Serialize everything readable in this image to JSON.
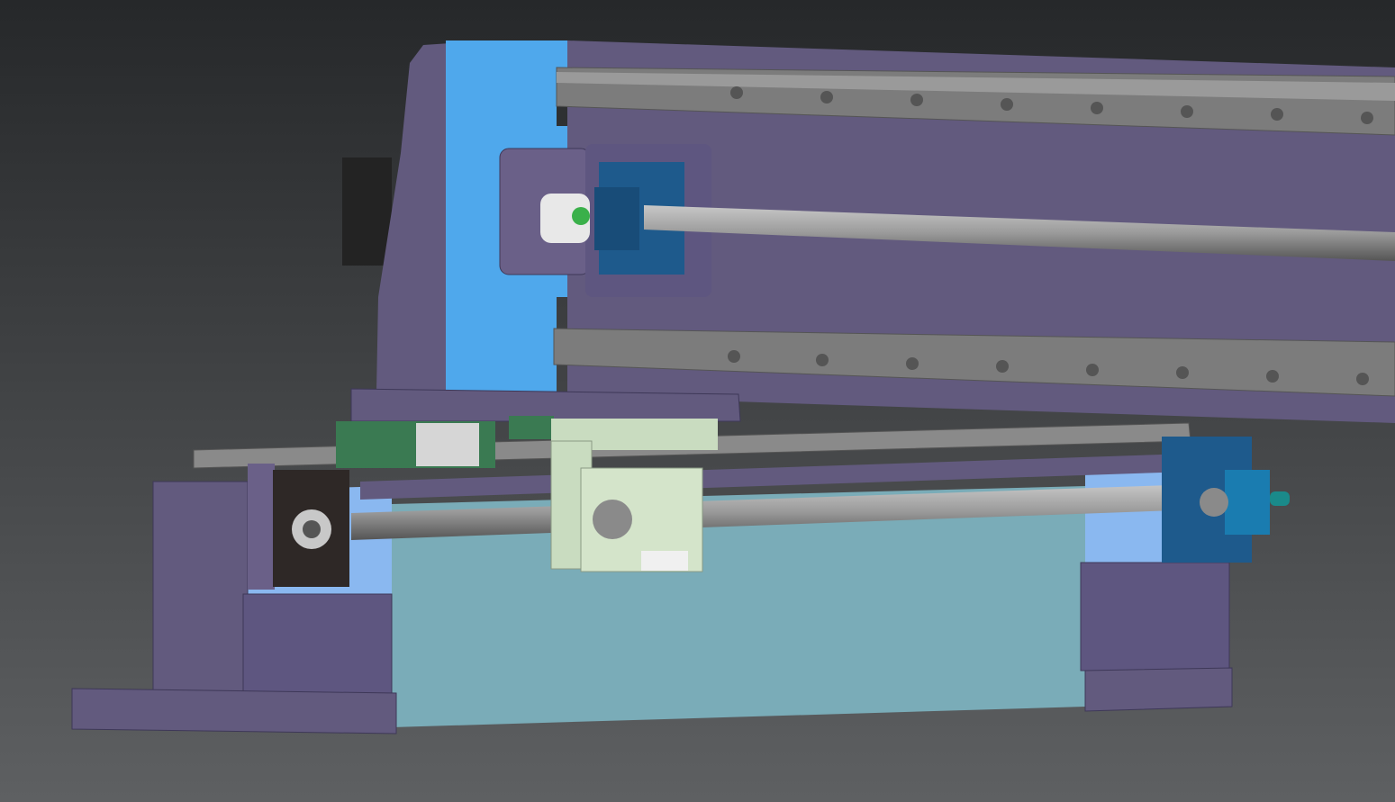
{
  "viewport": {
    "background_top": "#26282a",
    "background_bottom": "#5e6062"
  },
  "colors": {
    "frame_purple": "#625a7e",
    "frame_purple_dark": "#4e4868",
    "plate_blue": "#4fa8ec",
    "rail_gray": "#7c7c7c",
    "screw_gray": "#9a9a9a",
    "bearing_blue": "#1e5a8c",
    "bearing_black": "#2e2826",
    "carriage_green": "#3a7a52",
    "nut_block_green": "#c9dcc0",
    "trough_teal": "#7aacb8",
    "side_light_blue": "#8ab8f0",
    "motor_black": "#232323"
  }
}
